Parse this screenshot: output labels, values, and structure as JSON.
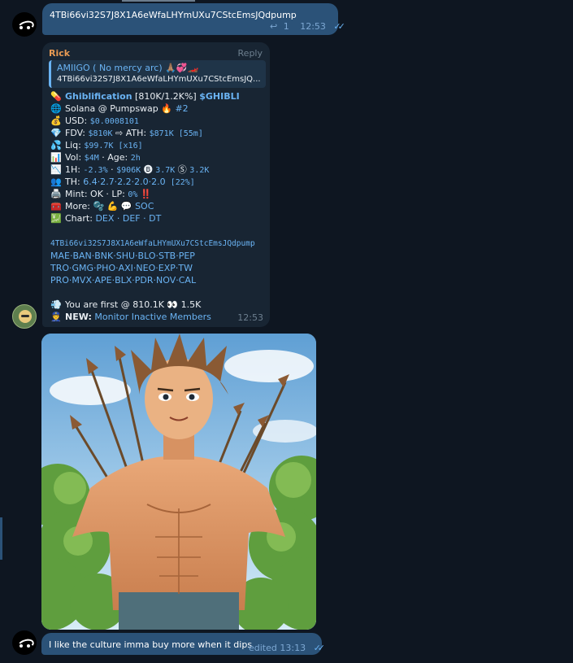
{
  "messages": {
    "m1": {
      "text": "4TBi66vi32S7J8X1A6eWfaLHYmUXu7CStcEmsJQdpump",
      "reply_icon": "↩",
      "replies": "1",
      "time": "12:53"
    },
    "m2": {
      "sender": "Rick",
      "reply_label": "Reply",
      "quote_name": "AMIIGO ( No mercy arc) 🙏🏽💞🏎️",
      "quote_text": "4TBi66vi32S7J8X1A6eWfaLHYmUXu7CStcEmsJQ...",
      "lines": {
        "l1_icon": "💊",
        "l1_a": "Ghiblification",
        "l1_b": " [810K/1.2K%] ",
        "l1_c": "$GHIBLI",
        "l2_icon": "🌐",
        "l2_a": "Solana @ Pumpswap 🔥 ",
        "l2_b": "#2",
        "l3_icon": "💰",
        "l3_a": "USD: ",
        "l3_b": "$0.0008101",
        "l4_icon": "💎",
        "l4_a": "FDV: ",
        "l4_b": "$810K",
        "l4_c": " ⇨ ATH: ",
        "l4_d": "$871K [55m]",
        "l5_icon": "💦",
        "l5_a": "Liq: ",
        "l5_b": "$99.7K [x16]",
        "l6_icon": "📊",
        "l6_a": "Vol: ",
        "l6_b": "$4M",
        "l6_c": " · Age: ",
        "l6_d": "2h",
        "l7_icon": "📉",
        "l7_a": "1H: ",
        "l7_b": "-2.3%",
        "l7_c": " · ",
        "l7_d": "$906K",
        "l7_e": " 🅑 ",
        "l7_f": "3.7K",
        "l7_g": " Ⓢ ",
        "l7_h": "3.2K",
        "l8_icon": "👥",
        "l8_a": "TH: ",
        "l8_b": "6.4·2.7·2.2·2.0·2.0",
        "l8_c": " [22%]",
        "l9_icon": "🖨️",
        "l9_a": "Mint: OK · LP: ",
        "l9_b": "0%",
        "l9_c": " ‼️",
        "l10_icon": "🧰",
        "l10_a": "More: ",
        "l10_b": "🫧 💪 💬 ",
        "l10_c": "SOC",
        "l11_icon": "💹",
        "l11_a": "Chart: ",
        "l11_b": "DEX · DEF · DT"
      },
      "address": "4TBi66vi32S7J8X1A6eWfaLHYmUXu7CStcEmsJQdpump",
      "links1": "MAE·BAN·BNK·SHU·BLO·STB·PEP",
      "links2": "TRO·GMG·PHO·AXI·NEO·EXP·TW",
      "links3": "PRO·MVX·APE·BLX·PDR·NOV·CAL",
      "first_icon": "💨",
      "first_text": "You are first @ 810.1K 👀 1.5K",
      "new_icon": "👮",
      "new_label": "NEW:",
      "new_link": " Monitor Inactive Members",
      "time": "12:53"
    },
    "m3": {
      "image_alt": "anime muscular shirtless man with arrows"
    },
    "m4": {
      "text": "I like the culture imma buy more when it dips",
      "edited": "edited 13:13"
    }
  },
  "colors": {
    "bg": "#0e1621",
    "out": "#2b5278",
    "in": "#182533",
    "link": "#6ab3f3",
    "sender": "#e89a53"
  }
}
